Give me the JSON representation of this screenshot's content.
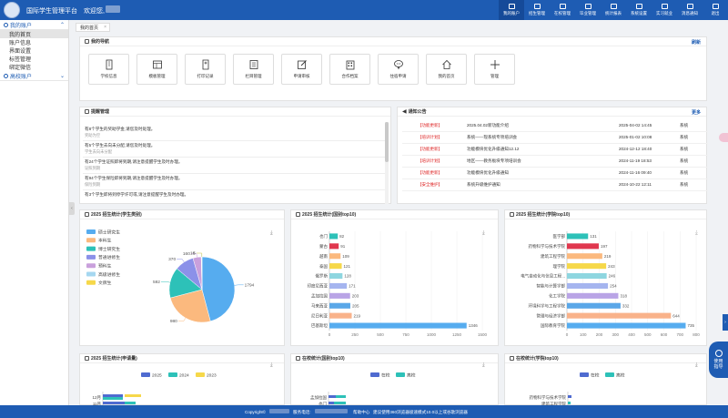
{
  "header": {
    "app_title": "国际学生管理平台",
    "welcome": "欢迎您,",
    "nav": [
      {
        "label": "我的账户",
        "icon": "user-icon",
        "active": true
      },
      {
        "label": "招生管理",
        "icon": "graduation-icon"
      },
      {
        "label": "在校管理",
        "icon": "building-icon"
      },
      {
        "label": "毕业管理",
        "icon": "diploma-icon"
      },
      {
        "label": "统计报表",
        "icon": "chart-icon"
      },
      {
        "label": "系统设置",
        "icon": "gear-icon"
      },
      {
        "label": "实习就业",
        "icon": "briefcase-icon"
      },
      {
        "label": "消息通知",
        "icon": "mail-icon"
      },
      {
        "label": "退出",
        "icon": "logout-icon"
      }
    ]
  },
  "sidebar": {
    "group1": "我的账户",
    "items": [
      "我的首页",
      "账户信息",
      "界面设置",
      "标签管理",
      "绑定微信"
    ],
    "group2": "高校账户"
  },
  "tabs": [
    {
      "label": "我的首页"
    }
  ],
  "quicknav": {
    "title": "我的导航",
    "refresh": "刷新",
    "items": [
      {
        "label": "学校信息",
        "icon": "school-icon"
      },
      {
        "label": "模板管理",
        "icon": "template-icon"
      },
      {
        "label": "打印记录",
        "icon": "print-icon"
      },
      {
        "label": "栏目管理",
        "icon": "column-icon"
      },
      {
        "label": "申请审核",
        "icon": "edit-icon"
      },
      {
        "label": "合作档案",
        "icon": "archive-icon"
      },
      {
        "label": "住宿申请",
        "icon": "chat-icon"
      },
      {
        "label": "我的首页",
        "icon": "home-icon"
      },
      {
        "label": "管理",
        "icon": "plus-icon"
      }
    ]
  },
  "reminders": {
    "title": "提醒管理",
    "items": [
      {
        "text": "有8个学生的奖助学金,请您及时处理。",
        "sub": "奖助为空"
      },
      {
        "text": "有5个学生去向未分配,请您及时处理。",
        "sub": "学生去向未分配"
      },
      {
        "text": "有24个学生证照即将到期,请注意提醒学生及时办理。",
        "sub": "证照到期"
      },
      {
        "text": "有94个学生保险即将到期,请注意提醒学生及时办理。",
        "sub": "保险到期"
      },
      {
        "text": "有3个学生即将到停学许可或,请注意提醒学生及时办理。",
        "sub": ""
      }
    ]
  },
  "notices": {
    "title": "通知公告",
    "more": "更多",
    "items": [
      {
        "tag": "【功能更新】",
        "title": "2025.04.02新功能介绍",
        "date": "2025-04-02 14:45",
        "src": "系统"
      },
      {
        "tag": "【培训计划】",
        "title": "系统——现系统专项培训会",
        "date": "2025-01-02 10:08",
        "src": "系统"
      },
      {
        "tag": "【功能更新】",
        "title": "功能模块优化升级通知12.12",
        "date": "2024-12-12 18:40",
        "src": "系统"
      },
      {
        "tag": "【培训计划】",
        "title": "地区——教务板块专项培训会",
        "date": "2024-11-19 18:53",
        "src": "系统"
      },
      {
        "tag": "【功能更新】",
        "title": "功能模块优化升级通知",
        "date": "2024-11-16 09:40",
        "src": "系统"
      },
      {
        "tag": "【安全维护】",
        "title": "系统升级维护通知",
        "date": "2024-10-22 12:11",
        "src": "系统"
      }
    ]
  },
  "colors": {
    "brand": "#1e5cb3",
    "bar_red": "#e0374e",
    "notice_red": "#d22"
  },
  "footer": {
    "copyright": "Copyright©",
    "hotline": "服务电话:",
    "help": "帮助中心",
    "browser": "建议使用360浏览器极速模式10.0以上或谷歌浏览器"
  },
  "float": {
    "line1": "使用",
    "line2": "指导"
  },
  "chart_data": [
    {
      "type": "pie",
      "title": "2025 招生统计(学生类别)",
      "categories": [
        "硕士研究生",
        "本科生",
        "博士研究生",
        "普通进修生",
        "预科生",
        "高级进修生",
        "文牌生"
      ],
      "values": [
        1794,
        980,
        592,
        370,
        160,
        10,
        5
      ],
      "colors": [
        "#56acef",
        "#fbb97e",
        "#2dc1b8",
        "#8b91e9",
        "#c9a0dc",
        "#a5d7f0",
        "#f6d84a"
      ],
      "legend": "left"
    },
    {
      "type": "bar",
      "orientation": "horizontal",
      "title": "2025 招生统计(国别top10)",
      "categories": [
        "也门",
        "蒙古",
        "越南",
        "泰国",
        "俄罗斯",
        "印度尼西亚",
        "孟加拉国",
        "马来西亚",
        "尼日利亚",
        "巴基斯坦"
      ],
      "values": [
        82,
        91,
        109,
        121,
        128,
        171,
        203,
        205,
        219,
        1346
      ],
      "colors": [
        "#2dc1b8",
        "#e0374e",
        "#fbb97e",
        "#f6d84a",
        "#8ed6e0",
        "#a5b5ef",
        "#b9a4e6",
        "#5aa7e8",
        "#f9b28a",
        "#56acef"
      ],
      "xlim": [
        0,
        1500
      ],
      "xticks": [
        0,
        250,
        500,
        750,
        1000,
        1250,
        1500
      ]
    },
    {
      "type": "bar",
      "orientation": "horizontal",
      "title": "2025 招生统计(学院top10)",
      "categories": [
        "医学部",
        "药物科学与技术学院",
        "建筑工程学院",
        "理学院",
        "电气自动化与信息工程...",
        "智能与计算学部",
        "化工学院",
        "环境科学与工程学院",
        "管理与经济学部",
        "国际教育学院"
      ],
      "values": [
        131,
        197,
        219,
        243,
        246,
        254,
        318,
        332,
        644,
        735
      ],
      "colors": [
        "#2dc1b8",
        "#e0374e",
        "#fbb97e",
        "#f6d84a",
        "#8ed6e0",
        "#a5b5ef",
        "#b9a4e6",
        "#5aa7e8",
        "#f9b28a",
        "#56acef"
      ],
      "xlim": [
        0,
        800
      ],
      "xticks": [
        0,
        100,
        200,
        300,
        400,
        500,
        600,
        700,
        800
      ]
    },
    {
      "type": "bar",
      "title": "2025 招生统计(申请量)",
      "series": [
        {
          "name": "2025",
          "color": "#4f6bd0"
        },
        {
          "name": "2024",
          "color": "#2dc1b8"
        },
        {
          "name": "2023",
          "color": "#f6d84a"
        }
      ],
      "categories": [
        "12月",
        "11月"
      ]
    },
    {
      "type": "bar",
      "title": "在校统计(国别top10)",
      "series": [
        {
          "name": "在校",
          "color": "#4f6bd0"
        },
        {
          "name": "离校",
          "color": "#2dc1b8"
        }
      ],
      "categories": [
        "孟加拉国",
        "也门"
      ]
    },
    {
      "type": "bar",
      "title": "在校统计(学院top10)",
      "series": [
        {
          "name": "在校",
          "color": "#4f6bd0"
        },
        {
          "name": "离校",
          "color": "#2dc1b8"
        }
      ],
      "categories": [
        "药物科学与技术学院",
        "建筑工程学院"
      ]
    }
  ]
}
